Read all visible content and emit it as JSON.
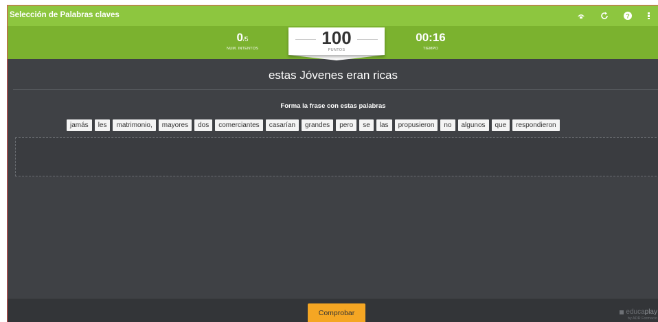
{
  "app": {
    "title": "Selección de Palabras claves"
  },
  "controls": [
    "fullscreen-icon",
    "restart-icon",
    "help-icon",
    "apps-icon"
  ],
  "score": {
    "attempts_value": "0",
    "attempts_total": "/5",
    "attempts_label": "NUM. INTENTOS",
    "points_value": "100",
    "points_label": "PUNTOS",
    "time_value": "00:16",
    "time_label": "TIEMPO"
  },
  "question": "estas Jóvenes eran ricas",
  "instruction": "Forma la frase con estas palabras",
  "words": [
    "jamás",
    "les",
    "matrimonio,",
    "mayores",
    "dos",
    "comerciantes",
    "casarían",
    "grandes",
    "pero",
    "se",
    "las",
    "propusieron",
    "no",
    "algunos",
    "que",
    "respondieron"
  ],
  "footer": {
    "submit_label": "Comprobar",
    "brand_name_part1": "educa",
    "brand_name_part2": "play",
    "brand_by": "by ADR Formacio"
  },
  "colors": {
    "header_green": "#8dc63f",
    "score_green": "#7bb22f",
    "background": "#3f4145",
    "footer": "#333538",
    "submit_orange": "#f5a623"
  }
}
